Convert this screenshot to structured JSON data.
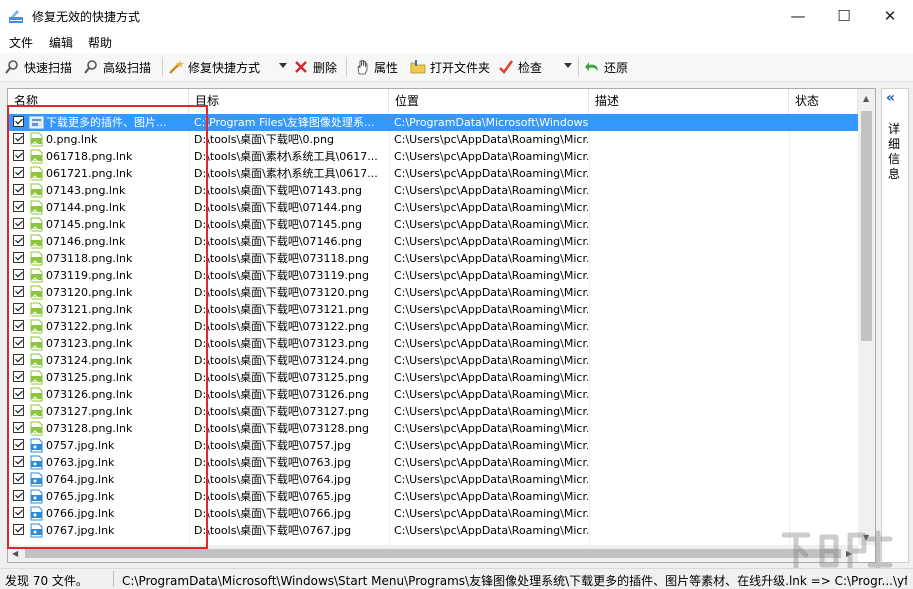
{
  "window": {
    "title": "修复无效的快捷方式",
    "minimize_glyph": "—",
    "maximize_glyph": "☐",
    "close_glyph": "✕"
  },
  "menu": [
    "文件",
    "编辑",
    "帮助"
  ],
  "toolbar": {
    "quick_scan": "快速扫描",
    "advanced_scan": "高级扫描",
    "fix_shortcut": "修复快捷方式",
    "delete": "删除",
    "properties": "属性",
    "open_folder": "打开文件夹",
    "check": "检查",
    "restore": "还原"
  },
  "columns": [
    "名称",
    "目标",
    "位置",
    "描述",
    "状态"
  ],
  "rows": [
    {
      "name": "下载更多的插件、图片...",
      "target": "C:\\Program Files\\友锋图像处理系...",
      "location": "C:\\ProgramData\\Microsoft\\Windows...",
      "icon": "shortcut-icon",
      "selected": true
    },
    {
      "name": "0.png.lnk",
      "target": "D:\\tools\\桌面\\下载吧\\0.png",
      "location": "C:\\Users\\pc\\AppData\\Roaming\\Micr...",
      "icon": "png-icon",
      "selected": false
    },
    {
      "name": "061718.png.lnk",
      "target": "D:\\tools\\桌面\\素材\\系统工具\\0617...",
      "location": "C:\\Users\\pc\\AppData\\Roaming\\Micr...",
      "icon": "png-icon",
      "selected": false
    },
    {
      "name": "061721.png.lnk",
      "target": "D:\\tools\\桌面\\素材\\系统工具\\0617...",
      "location": "C:\\Users\\pc\\AppData\\Roaming\\Micr...",
      "icon": "png-icon",
      "selected": false
    },
    {
      "name": "07143.png.lnk",
      "target": "D:\\tools\\桌面\\下载吧\\07143.png",
      "location": "C:\\Users\\pc\\AppData\\Roaming\\Micr...",
      "icon": "png-icon",
      "selected": false
    },
    {
      "name": "07144.png.lnk",
      "target": "D:\\tools\\桌面\\下载吧\\07144.png",
      "location": "C:\\Users\\pc\\AppData\\Roaming\\Micr...",
      "icon": "png-icon",
      "selected": false
    },
    {
      "name": "07145.png.lnk",
      "target": "D:\\tools\\桌面\\下载吧\\07145.png",
      "location": "C:\\Users\\pc\\AppData\\Roaming\\Micr...",
      "icon": "png-icon",
      "selected": false
    },
    {
      "name": "07146.png.lnk",
      "target": "D:\\tools\\桌面\\下载吧\\07146.png",
      "location": "C:\\Users\\pc\\AppData\\Roaming\\Micr...",
      "icon": "png-icon",
      "selected": false
    },
    {
      "name": "073118.png.lnk",
      "target": "D:\\tools\\桌面\\下载吧\\073118.png",
      "location": "C:\\Users\\pc\\AppData\\Roaming\\Micr...",
      "icon": "png-icon",
      "selected": false
    },
    {
      "name": "073119.png.lnk",
      "target": "D:\\tools\\桌面\\下载吧\\073119.png",
      "location": "C:\\Users\\pc\\AppData\\Roaming\\Micr...",
      "icon": "png-icon",
      "selected": false
    },
    {
      "name": "073120.png.lnk",
      "target": "D:\\tools\\桌面\\下载吧\\073120.png",
      "location": "C:\\Users\\pc\\AppData\\Roaming\\Micr...",
      "icon": "png-icon",
      "selected": false
    },
    {
      "name": "073121.png.lnk",
      "target": "D:\\tools\\桌面\\下载吧\\073121.png",
      "location": "C:\\Users\\pc\\AppData\\Roaming\\Micr...",
      "icon": "png-icon",
      "selected": false
    },
    {
      "name": "073122.png.lnk",
      "target": "D:\\tools\\桌面\\下载吧\\073122.png",
      "location": "C:\\Users\\pc\\AppData\\Roaming\\Micr...",
      "icon": "png-icon",
      "selected": false
    },
    {
      "name": "073123.png.lnk",
      "target": "D:\\tools\\桌面\\下载吧\\073123.png",
      "location": "C:\\Users\\pc\\AppData\\Roaming\\Micr...",
      "icon": "png-icon",
      "selected": false
    },
    {
      "name": "073124.png.lnk",
      "target": "D:\\tools\\桌面\\下载吧\\073124.png",
      "location": "C:\\Users\\pc\\AppData\\Roaming\\Micr...",
      "icon": "png-icon",
      "selected": false
    },
    {
      "name": "073125.png.lnk",
      "target": "D:\\tools\\桌面\\下载吧\\073125.png",
      "location": "C:\\Users\\pc\\AppData\\Roaming\\Micr...",
      "icon": "png-icon",
      "selected": false
    },
    {
      "name": "073126.png.lnk",
      "target": "D:\\tools\\桌面\\下载吧\\073126.png",
      "location": "C:\\Users\\pc\\AppData\\Roaming\\Micr...",
      "icon": "png-icon",
      "selected": false
    },
    {
      "name": "073127.png.lnk",
      "target": "D:\\tools\\桌面\\下载吧\\073127.png",
      "location": "C:\\Users\\pc\\AppData\\Roaming\\Micr...",
      "icon": "png-icon",
      "selected": false
    },
    {
      "name": "073128.png.lnk",
      "target": "D:\\tools\\桌面\\下载吧\\073128.png",
      "location": "C:\\Users\\pc\\AppData\\Roaming\\Micr...",
      "icon": "png-icon",
      "selected": false
    },
    {
      "name": "0757.jpg.lnk",
      "target": "D:\\tools\\桌面\\下载吧\\0757.jpg",
      "location": "C:\\Users\\pc\\AppData\\Roaming\\Micr...",
      "icon": "jpg-icon",
      "selected": false
    },
    {
      "name": "0763.jpg.lnk",
      "target": "D:\\tools\\桌面\\下载吧\\0763.jpg",
      "location": "C:\\Users\\pc\\AppData\\Roaming\\Micr...",
      "icon": "jpg-icon",
      "selected": false
    },
    {
      "name": "0764.jpg.lnk",
      "target": "D:\\tools\\桌面\\下载吧\\0764.jpg",
      "location": "C:\\Users\\pc\\AppData\\Roaming\\Micr...",
      "icon": "jpg-icon",
      "selected": false
    },
    {
      "name": "0765.jpg.lnk",
      "target": "D:\\tools\\桌面\\下载吧\\0765.jpg",
      "location": "C:\\Users\\pc\\AppData\\Roaming\\Micr...",
      "icon": "jpg-icon",
      "selected": false
    },
    {
      "name": "0766.jpg.lnk",
      "target": "D:\\tools\\桌面\\下载吧\\0766.jpg",
      "location": "C:\\Users\\pc\\AppData\\Roaming\\Micr...",
      "icon": "jpg-icon",
      "selected": false
    },
    {
      "name": "0767.jpg.lnk",
      "target": "D:\\tools\\桌面\\下载吧\\0767.jpg",
      "location": "C:\\Users\\pc\\AppData\\Roaming\\Micr...",
      "icon": "jpg-icon",
      "selected": false
    }
  ],
  "right_panel": {
    "collapse_glyph": "«",
    "label": "详细信息"
  },
  "status": {
    "found": "发现 70 文件。",
    "path": "C:\\ProgramData\\Microsoft\\Windows\\Start Menu\\Programs\\友锋图像处理系统\\下载更多的插件、图片等素材、在线升级.lnk => C:\\Progr...\\yfupdate.exe"
  },
  "watermark": {
    "label": "下载吧"
  },
  "colors": {
    "selection": "#3399ff",
    "highlight_box": "#e0262f",
    "png_icon": "#8cc63f",
    "jpg_icon": "#2e8bd6"
  }
}
